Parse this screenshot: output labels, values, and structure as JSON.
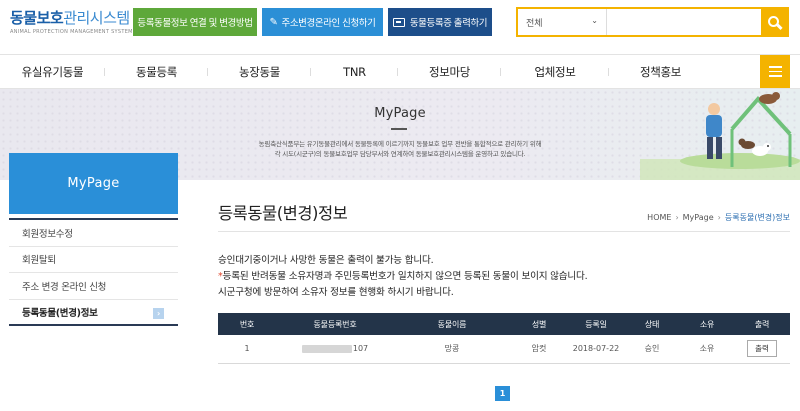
{
  "header": {
    "logo_main_a": "동물보호",
    "logo_main_b": "관리시스템",
    "logo_sub": "ANIMAL PROTECTION MANAGEMENT SYSTEM",
    "btn_register_link": "등록동물정보 연결 및 변경방법",
    "btn_address_change": "주소변경온라인 신청하기",
    "btn_print_cert": "동물등록증 출력하기",
    "search": {
      "scope": "전체",
      "placeholder": ""
    }
  },
  "nav": {
    "items": [
      "유실유기동물",
      "동물등록",
      "농장동물",
      "TNR",
      "정보마당",
      "업체정보",
      "정책홍보"
    ]
  },
  "hero": {
    "title": "MyPage",
    "desc_line1": "농림축산식품부는 유기동물관리에서 동물등록에 이르기까지 동물보호 업무 전반을 통합적으로 관리하기 위해",
    "desc_line2": "각 시도(시군구)의 동물보호업무 담당부서와 연계하여 동물보호관리시스템을 운영하고 있습니다."
  },
  "sidebar": {
    "title": "MyPage",
    "items": [
      {
        "label": "회원정보수정"
      },
      {
        "label": "회원탈퇴"
      },
      {
        "label": "주소 변경 온라인 신청"
      },
      {
        "label": "등록동물(변경)정보"
      }
    ]
  },
  "main": {
    "title": "등록동물(변경)정보",
    "breadcrumb": [
      "HOME",
      "MyPage",
      "등록동물(변경)정보"
    ],
    "notice_1": "승인대기중이거나 사망한 동물은 출력이 불가능 합니다.",
    "notice_2_star": "*",
    "notice_2": "등록된 반려동물 소유자명과 주민등록번호가 일치하지 않으면 등록된 동물이 보이지 않습니다.",
    "notice_3": "시군구청에 방문하여 소유자 정보를 현행화 하시기 바랍니다.",
    "table": {
      "headers": [
        "번호",
        "동물등록번호",
        "동물이름",
        "성별",
        "등록일",
        "상태",
        "소유",
        "출력"
      ],
      "rows": [
        {
          "no": "1",
          "reg_no_suffix": "107",
          "name": "망콩",
          "sex": "암컷",
          "date": "2018-07-22",
          "status": "승인",
          "own": "소유",
          "print": "출력"
        }
      ]
    },
    "pagination": {
      "current": "1"
    }
  }
}
